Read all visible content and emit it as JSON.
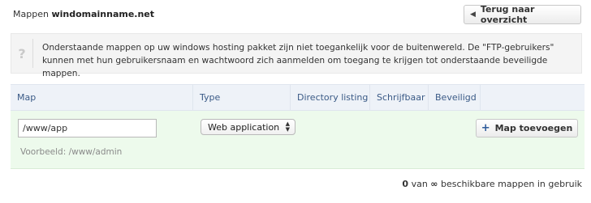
{
  "header": {
    "prefix": "Mappen",
    "domain": "windomainname.net",
    "back_label": "Terug naar overzicht"
  },
  "info": {
    "icon": "?",
    "text": "Onderstaande mappen op uw windows hosting pakket zijn niet toegankelijk voor de buitenwereld. De \"FTP-gebruikers\" kunnen met hun gebruikersnaam en wachtwoord zich aanmelden om toegang te krijgen tot onderstaande beveiligde mappen."
  },
  "table": {
    "columns": [
      "Map",
      "Type",
      "Directory listing",
      "Schrijfbaar",
      "Beveiligd"
    ],
    "row": {
      "map_value": "/www/app",
      "example": "Voorbeeld: /www/admin",
      "type_selected": "Web application",
      "add_label": "Map toevoegen"
    }
  },
  "footer": {
    "count": "0",
    "van": "van",
    "infinity": "∞",
    "suffix": "beschikbare mappen in gebruik"
  }
}
